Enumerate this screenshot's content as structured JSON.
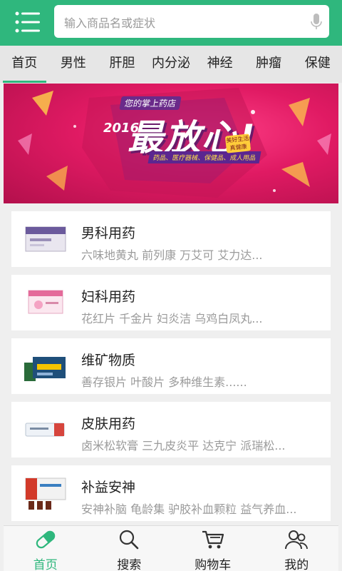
{
  "header": {
    "search_placeholder": "输入商品名或症状"
  },
  "tabs": [
    {
      "label": "首页",
      "active": true
    },
    {
      "label": "男性"
    },
    {
      "label": "肝胆"
    },
    {
      "label": "内分泌"
    },
    {
      "label": "神经"
    },
    {
      "label": "肿瘤"
    },
    {
      "label": "保健"
    }
  ],
  "banner": {
    "tag": "您的掌上药店",
    "year": "2016",
    "title": "最放心!",
    "subtitle": "药品、医疗器械、保健品、成人用品",
    "badge": "美好生活 真健康"
  },
  "categories": [
    {
      "title": "男科用药",
      "desc": "六味地黄丸 前列康 万艾可 艾力达..."
    },
    {
      "title": "妇科用药",
      "desc": "花红片 千金片 妇炎洁 乌鸡白凤丸..."
    },
    {
      "title": "维矿物质",
      "desc": "善存银片 叶酸片 多种维生素......"
    },
    {
      "title": "皮肤用药",
      "desc": "卤米松软膏 三九皮炎平 达克宁 派瑞松..."
    },
    {
      "title": "补益安神",
      "desc": "安神补脑 龟龄集 驴胶补血颗粒 益气养血..."
    }
  ],
  "bottom_nav": [
    {
      "label": "首页",
      "icon": "pill-icon",
      "active": true
    },
    {
      "label": "搜索",
      "icon": "search-icon"
    },
    {
      "label": "购物车",
      "icon": "cart-icon"
    },
    {
      "label": "我的",
      "icon": "user-icon"
    }
  ],
  "colors": {
    "primary": "#2fb77d",
    "banner": "#e01a63"
  }
}
